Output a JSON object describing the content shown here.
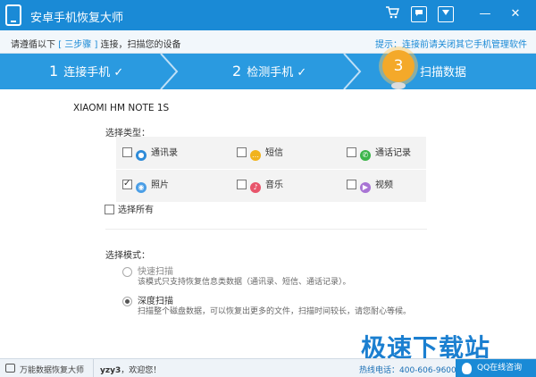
{
  "app": {
    "title": "安卓手机恢复大师"
  },
  "titlebar": {
    "cart_icon": "cart-icon",
    "message_icon": "message-icon",
    "menu_icon": "menu-icon",
    "minimize": "—",
    "close": "✕"
  },
  "infobar": {
    "prefix": "请遵循以下",
    "highlight": "[ 三步骤 ]",
    "suffix": "连接，扫描您的设备",
    "tip": "提示：连接前请关闭其它手机管理软件"
  },
  "steps": [
    {
      "num": "1",
      "label": "连接手机",
      "check": "✓"
    },
    {
      "num": "2",
      "label": "检测手机",
      "check": "✓"
    },
    {
      "num": "3",
      "label": "扫描数据"
    }
  ],
  "device": {
    "name": "XIAOMI HM NOTE 1S"
  },
  "types": {
    "label": "选择类型：",
    "items": [
      {
        "label": "通讯录",
        "checked": false,
        "color": "#2e8bd8",
        "glyph": "●"
      },
      {
        "label": "短信",
        "checked": false,
        "color": "#f1b31c",
        "glyph": "…"
      },
      {
        "label": "通话记录",
        "checked": false,
        "color": "#3cb54a",
        "glyph": "✆"
      },
      {
        "label": "照片",
        "checked": true,
        "color": "#4a9ee6",
        "glyph": "◉"
      },
      {
        "label": "音乐",
        "checked": false,
        "color": "#e8556b",
        "glyph": "♪"
      },
      {
        "label": "视频",
        "checked": false,
        "color": "#a874d4",
        "glyph": "▶"
      }
    ],
    "select_all": "选择所有"
  },
  "mode": {
    "label": "选择模式：",
    "options": [
      {
        "title": "快速扫描",
        "desc": "该模式只支持恢复信息类数据（通讯录、短信、通话记录）。",
        "selected": false
      },
      {
        "title": "深度扫描",
        "desc": "扫描整个磁盘数据，可以恢复出更多的文件，扫描时间较长，请您耐心等候。",
        "selected": true
      }
    ]
  },
  "watermark": {
    "text": "极速下载站"
  },
  "statusbar": {
    "left": "万能数据恢复大师",
    "user": "yzy3",
    "welcome": "，欢迎您！",
    "hotline": "热线电话：400-606-9600",
    "qq": "QQ在线咨询"
  }
}
